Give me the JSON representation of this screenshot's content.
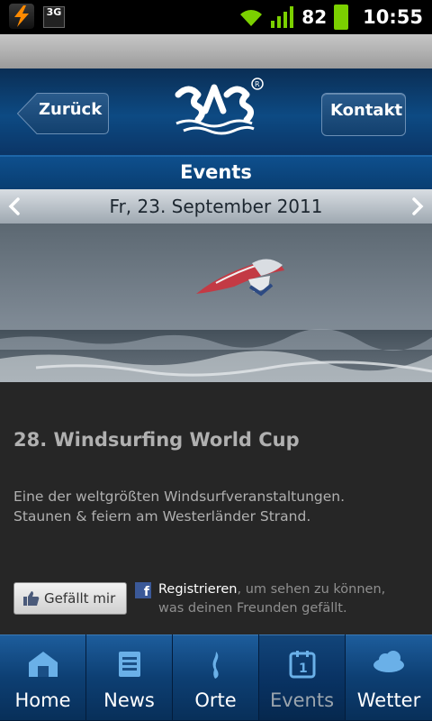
{
  "status_bar": {
    "battery_percent": "82",
    "time": "10:55",
    "network": "3G"
  },
  "header": {
    "back_label": "Zurück",
    "contact_label": "Kontakt",
    "logo_name": "sylt-logo"
  },
  "title": "Events",
  "date_nav": {
    "date": "Fr, 23. September 2011"
  },
  "event": {
    "title": "28. Windsurfing World Cup",
    "description_line1": "Eine der weltgrößten Windsurfveranstaltungen.",
    "description_line2": "Staunen & feiern am Westerländer Strand."
  },
  "facebook": {
    "like_label": "Gefällt mir",
    "register_link": "Registrieren",
    "register_text1": ", um sehen zu können,",
    "register_text2": "was deinen Freunden gefällt."
  },
  "tabs": [
    {
      "label": "Home",
      "icon": "home-icon"
    },
    {
      "label": "News",
      "icon": "news-icon"
    },
    {
      "label": "Orte",
      "icon": "places-icon"
    },
    {
      "label": "Events",
      "icon": "calendar-icon",
      "active": true
    },
    {
      "label": "Wetter",
      "icon": "weather-icon"
    }
  ],
  "colors": {
    "header_blue": "#0d4a83",
    "content_bg": "#262626",
    "battery_green": "#7bd000"
  }
}
